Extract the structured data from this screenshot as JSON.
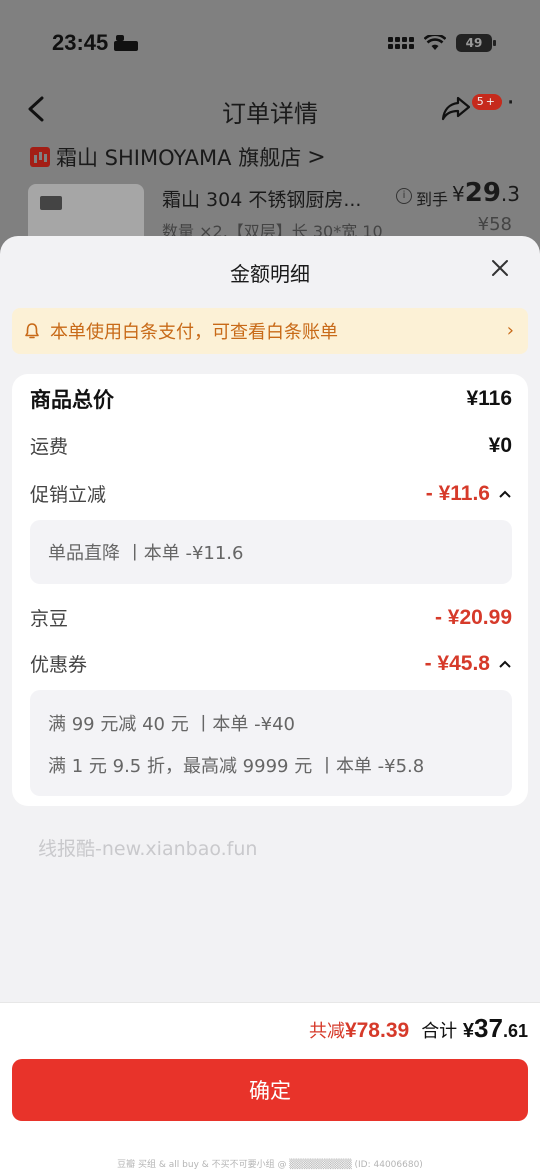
{
  "status_bar": {
    "time": "23:45",
    "battery": "49"
  },
  "nav": {
    "title": "订单详情",
    "badge": "5+"
  },
  "order": {
    "store_name": "霜山 SHIMOYAMA 旗舰店",
    "store_chevron": ">",
    "product_name": "霜山 304 不锈钢厨房...",
    "product_spec": "数量 ×2,【双层】长 30*宽 10",
    "price_label": "到手",
    "price_currency": "¥",
    "price_int": "29",
    "price_dec": ".3",
    "price_original": "¥58"
  },
  "sheet": {
    "title": "金额明细",
    "notice": "本单使用白条支付，可查看白条账单",
    "notice_chevron": "›",
    "rows": [
      {
        "label": "商品总价",
        "value": "¥116"
      },
      {
        "label": "运费",
        "value": "¥0"
      },
      {
        "label": "促销立减",
        "value": "- ¥11.6"
      },
      {
        "label": "京豆",
        "value": "- ¥20.99"
      },
      {
        "label": "优惠券",
        "value": "- ¥45.8"
      }
    ],
    "promo_detail": [
      "单品直降 丨本单 -¥11.6"
    ],
    "coupon_detail": [
      "满 99 元减 40 元 丨本单 -¥40",
      "满 1 元 9.5 折，最高减 9999 元 丨本单 -¥5.8"
    ],
    "watermark": "线报酷-new.xianbao.fun"
  },
  "footer": {
    "reduce_label": "共减",
    "reduce_value": "¥78.39",
    "total_label": "合计",
    "total_currency": "¥",
    "total_int": "37",
    "total_dec": ".61",
    "confirm": "确定",
    "credit": "豆瓣 买组 & all buy & 不买不可要小组 @ ▒▒▒▒▒▒▒▒▒ (ID: 44006680)"
  },
  "colors": {
    "accent": "#e8332a",
    "discount": "#d63a2a",
    "notice_bg": "#fcf1d6",
    "notice_text": "#c86a18"
  }
}
